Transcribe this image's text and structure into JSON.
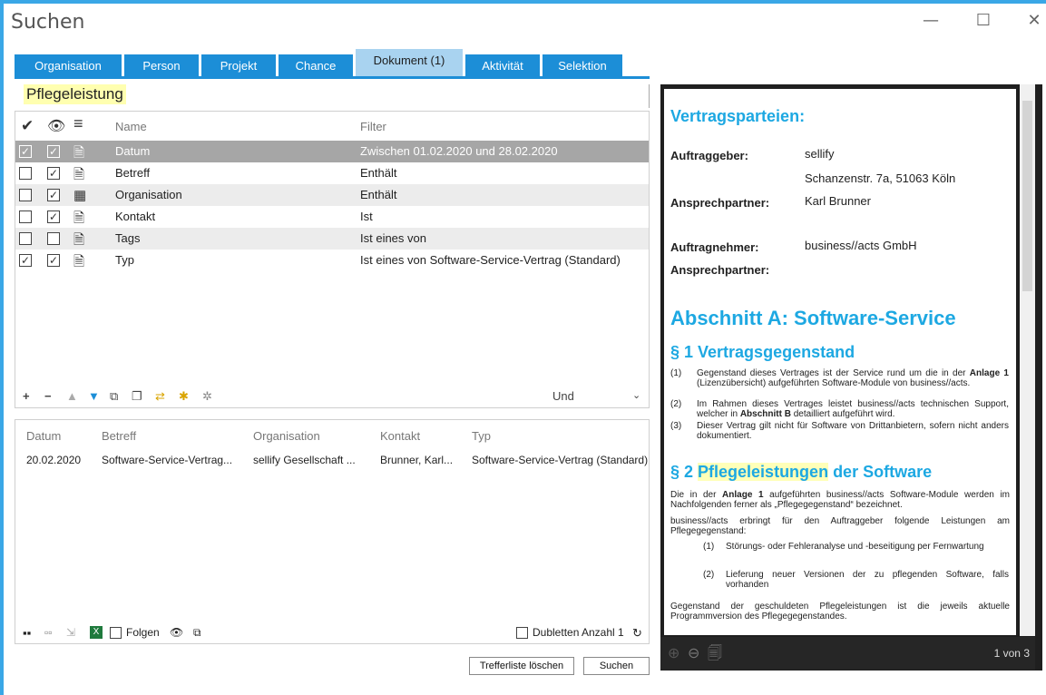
{
  "window": {
    "title": "Suchen",
    "minimize": "—",
    "maximize": "☐",
    "close": "✕"
  },
  "tabs": [
    {
      "label": "Organisation"
    },
    {
      "label": "Person"
    },
    {
      "label": "Projekt"
    },
    {
      "label": "Chance"
    },
    {
      "label": "Dokument (1)",
      "active": true
    },
    {
      "label": "Aktivität"
    },
    {
      "label": "Selektion"
    }
  ],
  "search": {
    "value": "Pflegeleistung"
  },
  "filter": {
    "headers": {
      "name": "Name",
      "filter": "Filter"
    },
    "rows": [
      {
        "name": "Datum",
        "filter": "Zwischen 01.02.2020 und 28.02.2020"
      },
      {
        "name": "Betreff",
        "filter": "Enthält"
      },
      {
        "name": "Organisation",
        "filter": "Enthält"
      },
      {
        "name": "Kontakt",
        "filter": "Ist"
      },
      {
        "name": "Tags",
        "filter": "Ist eines von"
      },
      {
        "name": "Typ",
        "filter": "Ist eines von Software-Service-Vertrag (Standard)"
      }
    ],
    "logic": "Und"
  },
  "results": {
    "headers": [
      "Datum",
      "Betreff",
      "Organisation",
      "Kontakt",
      "Typ"
    ],
    "row": [
      "20.02.2020",
      "Software-Service-Vertrag...",
      "sellify  Gesellschaft ...",
      "Brunner, Karl...",
      "Software-Service-Vertrag (Standard)"
    ],
    "follow_label": "Folgen",
    "duplicates_label": "Dubletten",
    "count_label": "Anzahl 1"
  },
  "buttons": {
    "clear": "Trefferliste löschen",
    "search": "Suchen"
  },
  "preview": {
    "parties_heading": "Vertragsparteien:",
    "client_label": "Auftraggeber:",
    "client_name": "sellify",
    "client_address": "Schanzenstr. 7a, 51063 Köln",
    "contact_label": "Ansprechpartner:",
    "contact_name": "Karl Brunner",
    "contractor_label": "Auftragnehmer:",
    "contractor_name": "business//acts GmbH",
    "contact2_label": "Ansprechpartner:",
    "section_heading": "Abschnitt A: Software-Service",
    "p1_heading": "§ 1 Vertragsgegenstand",
    "p1_items": [
      {
        "num": "(1)",
        "text_a": "Gegenstand dieses Vertrages ist der Service rund um die in der ",
        "bold": "Anlage 1",
        "text_b": " (Lizenzübersicht) aufgeführten Software-Module von business//acts."
      },
      {
        "num": "(2)",
        "text_a": "Im Rahmen dieses Vertrages leistet business//acts technischen Support, welcher in ",
        "bold": "Abschnitt B",
        "text_b": " detailliert aufgeführt wird."
      },
      {
        "num": "(3)",
        "text_a": "Dieser Vertrag gilt nicht für Software von Drittanbietern, sofern nicht anders dokumentiert.",
        "bold": "",
        "text_b": ""
      }
    ],
    "p2_prefix": "§ 2 ",
    "p2_highlight": "Pflegeleistungen",
    "p2_suffix": " der Software",
    "p2_text1_a": "Die in der ",
    "p2_text1_bold": "Anlage 1",
    "p2_text1_b": " aufgeführten business//acts Software-Module werden im Nachfolgenden ferner als „Pflegegegenstand“ bezeichnet.",
    "p2_text2": "business//acts erbringt für den Auftraggeber folgende Leistungen am Pflegegegenstand:",
    "p2_items": [
      {
        "num": "(1)",
        "text": "Störungs- oder Fehleranalyse und -beseitigung per Fernwartung"
      },
      {
        "num": "(2)",
        "text": "Lieferung neuer Versionen der zu pflegenden Software, falls vorhanden"
      }
    ],
    "p2_text3": "Gegenstand der geschuldeten Pflegeleistungen ist die jeweils aktuelle Programmversion des Pflegegegenstandes.",
    "page_indicator": "1 von 3"
  }
}
